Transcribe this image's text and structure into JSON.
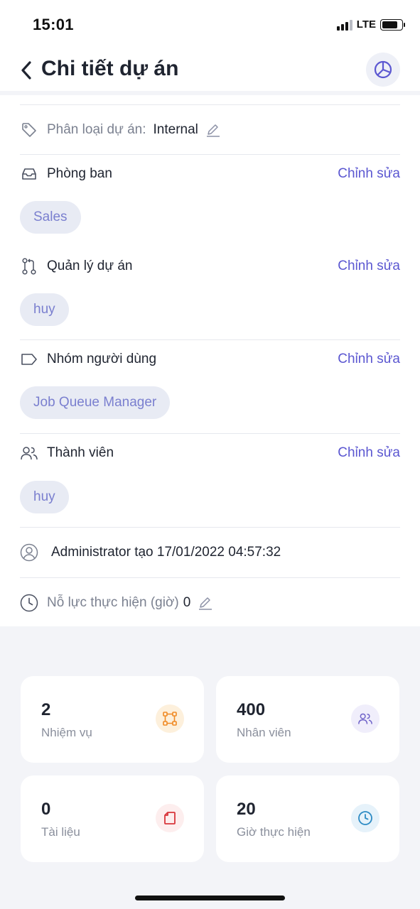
{
  "status_bar": {
    "time": "15:01",
    "network": "LTE"
  },
  "header": {
    "title": "Chi tiết dự án",
    "back_icon": "chevron-left-icon",
    "chart_icon": "pie-chart-icon"
  },
  "project_type": {
    "label": "Phân loại dự án:",
    "value": "Internal"
  },
  "sections": {
    "department": {
      "label": "Phòng ban",
      "edit": "Chỉnh sửa",
      "chips": [
        "Sales"
      ]
    },
    "manager": {
      "label": "Quản lý dự án",
      "edit": "Chỉnh sửa",
      "chips": [
        "huy"
      ]
    },
    "user_group": {
      "label": "Nhóm người dùng",
      "edit": "Chỉnh sửa",
      "chips": [
        "Job Queue Manager"
      ]
    },
    "members": {
      "label": "Thành viên",
      "edit": "Chỉnh sửa",
      "chips": [
        "huy"
      ]
    }
  },
  "created": {
    "text": "Administrator tạo 17/01/2022 04:57:32"
  },
  "effort": {
    "label": "Nỗ lực thực hiện (giờ)",
    "value": "0"
  },
  "stats": [
    {
      "value": "2",
      "caption": "Nhiệm vụ",
      "icon": "tasks-icon",
      "color": "#f08a24",
      "bg": "#fdf0dc"
    },
    {
      "value": "400",
      "caption": "Nhân viên",
      "icon": "users-icon",
      "color": "#6f63c9",
      "bg": "#f0eefb"
    },
    {
      "value": "0",
      "caption": "Tài liệu",
      "icon": "document-icon",
      "color": "#d8353b",
      "bg": "#fdeeee"
    },
    {
      "value": "20",
      "caption": "Giờ thực hiện",
      "icon": "clock-icon",
      "color": "#2d8bc4",
      "bg": "#e6f2fa"
    }
  ]
}
